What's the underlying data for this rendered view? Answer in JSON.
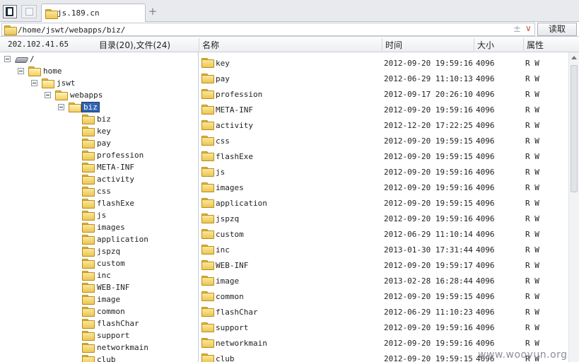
{
  "tab": {
    "label": "js.189.cn"
  },
  "address": {
    "path": "/home/jswt/webapps/biz/",
    "plus_glyph": "±",
    "read_button": "读取"
  },
  "header": {
    "ip": "202.102.41.65",
    "summary": "目录(20),文件(24)",
    "col_name": "名称",
    "col_time": "时间",
    "col_size": "大小",
    "col_attr": "属性"
  },
  "tree": {
    "root": "/",
    "home": "home",
    "jswt": "jswt",
    "webapps": "webapps",
    "biz": "biz",
    "children": [
      "biz",
      "key",
      "pay",
      "profession",
      "META-INF",
      "activity",
      "css",
      "flashExe",
      "js",
      "images",
      "application",
      "jspzq",
      "custom",
      "inc",
      "WEB-INF",
      "image",
      "common",
      "flashChar",
      "support",
      "networkmain",
      "club"
    ]
  },
  "files": [
    {
      "name": "key",
      "time": "2012-09-20 19:59:16",
      "size": "4096",
      "attr": "R W"
    },
    {
      "name": "pay",
      "time": "2012-06-29 11:10:13",
      "size": "4096",
      "attr": "R W"
    },
    {
      "name": "profession",
      "time": "2012-09-17 20:26:10",
      "size": "4096",
      "attr": "R W"
    },
    {
      "name": "META-INF",
      "time": "2012-09-20 19:59:16",
      "size": "4096",
      "attr": "R W"
    },
    {
      "name": "activity",
      "time": "2012-12-20 17:22:25",
      "size": "4096",
      "attr": "R W"
    },
    {
      "name": "css",
      "time": "2012-09-20 19:59:15",
      "size": "4096",
      "attr": "R W"
    },
    {
      "name": "flashExe",
      "time": "2012-09-20 19:59:15",
      "size": "4096",
      "attr": "R W"
    },
    {
      "name": "js",
      "time": "2012-09-20 19:59:16",
      "size": "4096",
      "attr": "R W"
    },
    {
      "name": "images",
      "time": "2012-09-20 19:59:16",
      "size": "4096",
      "attr": "R W"
    },
    {
      "name": "application",
      "time": "2012-09-20 19:59:15",
      "size": "4096",
      "attr": "R W"
    },
    {
      "name": "jspzq",
      "time": "2012-09-20 19:59:16",
      "size": "4096",
      "attr": "R W"
    },
    {
      "name": "custom",
      "time": "2012-06-29 11:10:14",
      "size": "4096",
      "attr": "R W"
    },
    {
      "name": "inc",
      "time": "2013-01-30 17:31:44",
      "size": "4096",
      "attr": "R W"
    },
    {
      "name": "WEB-INF",
      "time": "2012-09-20 19:59:17",
      "size": "4096",
      "attr": "R W"
    },
    {
      "name": "image",
      "time": "2013-02-28 16:28:44",
      "size": "4096",
      "attr": "R W"
    },
    {
      "name": "common",
      "time": "2012-09-20 19:59:15",
      "size": "4096",
      "attr": "R W"
    },
    {
      "name": "flashChar",
      "time": "2012-06-29 11:10:23",
      "size": "4096",
      "attr": "R W"
    },
    {
      "name": "support",
      "time": "2012-09-20 19:59:16",
      "size": "4096",
      "attr": "R W"
    },
    {
      "name": "networkmain",
      "time": "2012-09-20 19:59:16",
      "size": "4096",
      "attr": "R W"
    },
    {
      "name": "club",
      "time": "2012-09-20 19:59:15",
      "size": "4096",
      "attr": "R W"
    }
  ],
  "watermark": "www.wooyun.org",
  "colors": {
    "selection": "#3064b4",
    "folder": "#edc653"
  }
}
